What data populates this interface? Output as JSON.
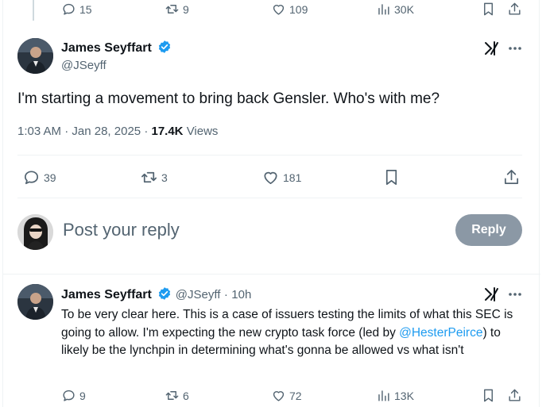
{
  "top_actions": {
    "replies": "15",
    "reposts": "9",
    "likes": "109",
    "views": "30K"
  },
  "main_tweet": {
    "author_name": "James Seyffart",
    "author_handle": "@JSeyff",
    "text": "I'm starting a movement to bring back Gensler. Who's with me?",
    "time": "1:03 AM",
    "date_sep": "·",
    "date": "Jan 28, 2025",
    "views_sep": "·",
    "views_count": "17.4K",
    "views_label": "Views",
    "replies": "39",
    "reposts": "3",
    "likes": "181"
  },
  "reply_box": {
    "placeholder": "Post your reply",
    "button_label": "Reply"
  },
  "reply_tweet": {
    "author_name": "James Seyffart",
    "author_handle": "@JSeyff",
    "dot": "·",
    "age": "10h",
    "text_before": "To be very clear here. This is a case of issuers testing the limits of what this SEC is going to allow. I'm expecting the new crypto task force (led by ",
    "mention": "@HesterPeirce",
    "text_after": ") to likely be the lynchpin in determining what's gonna be allowed vs what isn't",
    "replies": "9",
    "reposts": "6",
    "likes": "72",
    "views": "13K"
  },
  "colors": {
    "verified": "#1d9bf0",
    "muted": "#536471",
    "link": "#1d9bf0",
    "reply_button_bg": "#8b98a5"
  }
}
